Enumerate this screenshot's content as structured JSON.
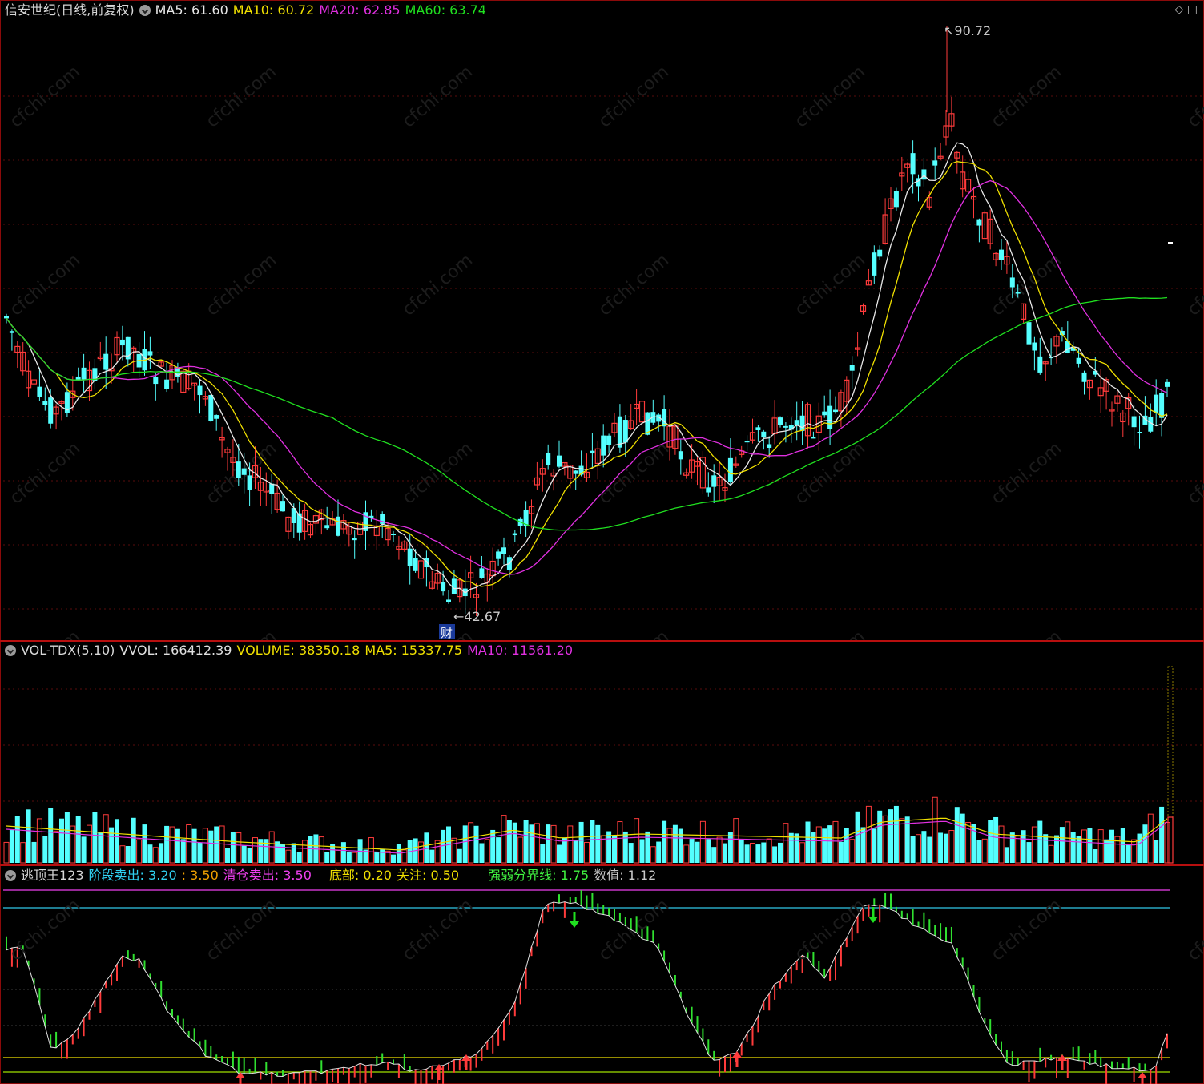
{
  "main": {
    "title": "信安世纪(日线,前复权)",
    "ma_labels": [
      {
        "label": "MA5: 61.60",
        "color": "#e8e8e8"
      },
      {
        "label": "MA10: 60.72",
        "color": "#f0e000"
      },
      {
        "label": "MA20: 62.85",
        "color": "#e030e0"
      },
      {
        "label": "MA60: 63.74",
        "color": "#20e020"
      }
    ],
    "high_label": "90.72",
    "low_label": "42.67",
    "event_badge": "财",
    "window_icons": "◇ □"
  },
  "volume": {
    "indicator": "VOL-TDX(5,10)",
    "labels": [
      {
        "label": "VVOL: 166412.39",
        "color": "#e0e0e0"
      },
      {
        "label": "VOLUME: 38350.18",
        "color": "#f0e000"
      },
      {
        "label": "MA5: 15337.75",
        "color": "#f0e000"
      },
      {
        "label": "MA10: 11561.20",
        "color": "#e030e0"
      }
    ]
  },
  "indicator": {
    "name": "逃顶王123",
    "labels": [
      {
        "label": "阶段卖出: 3.20",
        "color": "#30d0f0"
      },
      {
        "label": ": 3.50",
        "color": "#f0a000"
      },
      {
        "label": "清仓卖出: 3.50",
        "color": "#f040f0"
      },
      {
        "label": "底部: 0.20",
        "color": "#f0e000"
      },
      {
        "label": "关注: 0.50",
        "color": "#f0e000"
      },
      {
        "label": "强弱分界线: 1.75",
        "color": "#40f040"
      },
      {
        "label": "数值: 1.12",
        "color": "#c8c8c8"
      }
    ]
  },
  "colors": {
    "up": "#ff3b3b",
    "down": "#54ffff",
    "ma5": "#e8e8e8",
    "ma10": "#f0e000",
    "ma20": "#e030e0",
    "ma60": "#20e020",
    "border": "#b80f0f",
    "watermark": "cfchi.com"
  }
}
